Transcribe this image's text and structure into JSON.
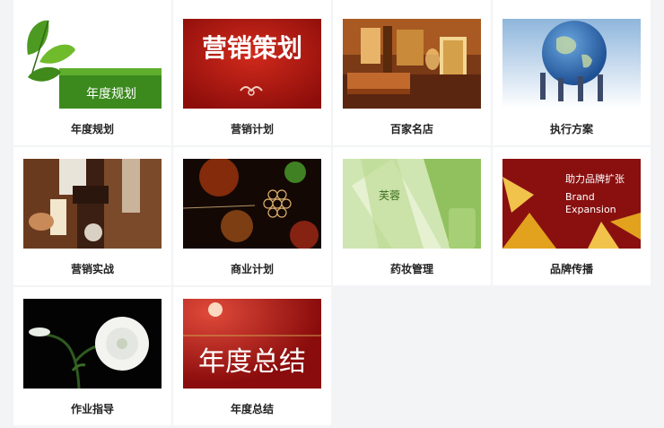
{
  "items": [
    {
      "caption": "年度规划",
      "thumb_text": "年度规划"
    },
    {
      "caption": "营销计划",
      "thumb_text": "营销策划"
    },
    {
      "caption": "百家名店",
      "thumb_text": ""
    },
    {
      "caption": "执行方案",
      "thumb_text": ""
    },
    {
      "caption": "营销实战",
      "thumb_text": ""
    },
    {
      "caption": "商业计划",
      "thumb_text": ""
    },
    {
      "caption": "药妆管理",
      "thumb_text": "芙蓉"
    },
    {
      "caption": "品牌传播",
      "thumb_text": "助力品牌扩张",
      "thumb_text2": "Brand",
      "thumb_text3": "Expansion"
    },
    {
      "caption": "作业指导",
      "thumb_text": ""
    },
    {
      "caption": "年度总结",
      "thumb_text": "年度总结"
    }
  ]
}
